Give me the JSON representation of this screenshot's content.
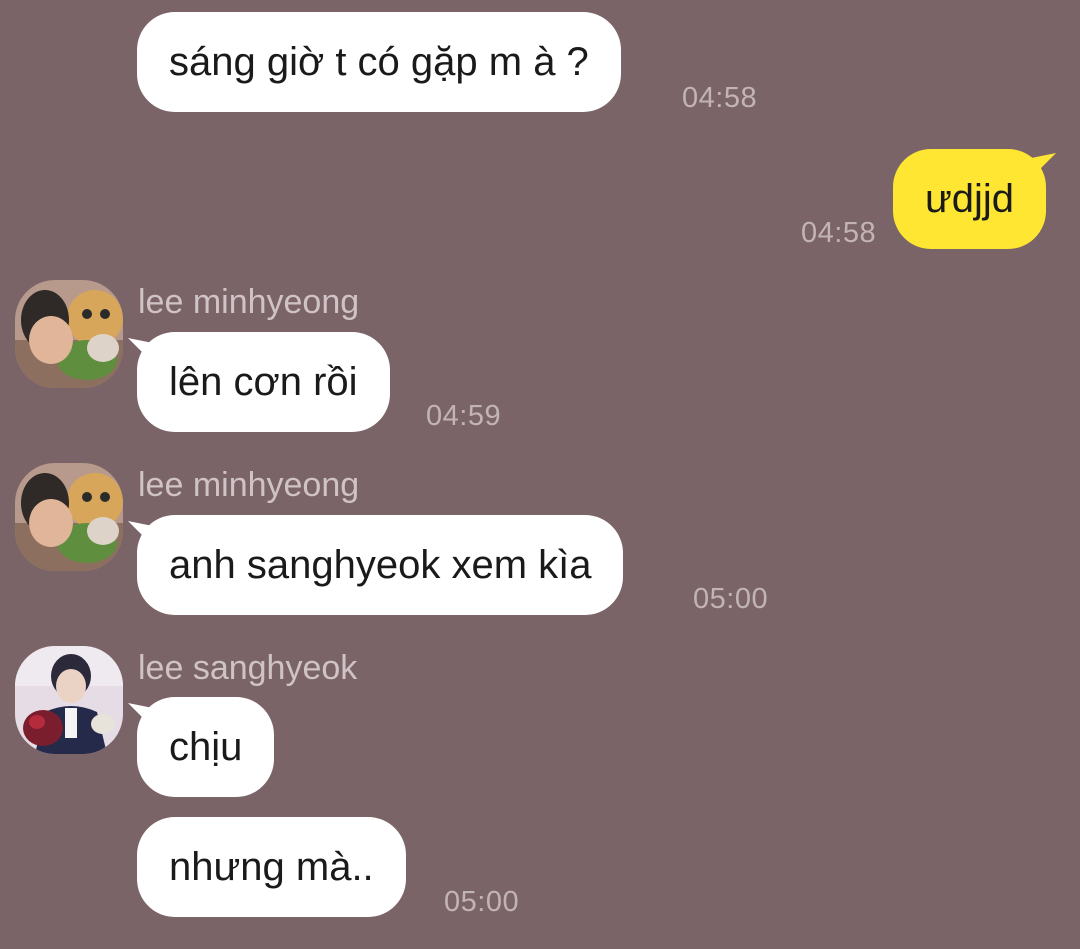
{
  "chat": {
    "background_color": "#7b6468",
    "my_bubble_color": "#fee633",
    "their_bubble_color": "#ffffff",
    "messages": [
      {
        "text": "sáng giờ t có gặp m à ?",
        "time": "04:58"
      },
      {
        "text": "ưdjjd",
        "time": "04:58",
        "mine": true
      },
      {
        "sender": "lee minhyeong",
        "text": "lên cơn rồi",
        "time": "04:59"
      },
      {
        "sender": "lee minhyeong",
        "text": "anh sanghyeok xem kìa",
        "time": "05:00"
      },
      {
        "sender": "lee sanghyeok",
        "text": "chịu"
      },
      {
        "text": "nhưng mà..",
        "time": "05:00"
      }
    ]
  }
}
